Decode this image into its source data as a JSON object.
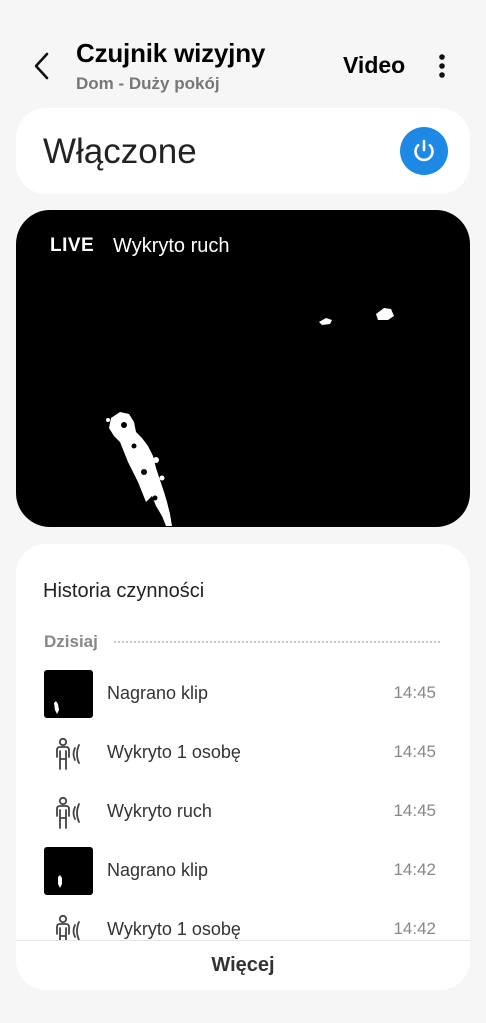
{
  "header": {
    "title": "Czujnik wizyjny",
    "subtitle": "Dom - Duży pokój",
    "video_label": "Video"
  },
  "status": {
    "text": "Włączone",
    "power_on": true,
    "accent": "#1e88e5"
  },
  "live": {
    "badge": "LIVE",
    "status": "Wykryto ruch"
  },
  "history": {
    "title": "Historia czynności",
    "date_label": "Dzisiaj",
    "items": [
      {
        "type": "clip",
        "icon": "clip-thumbnail",
        "label": "Nagrano klip",
        "time": "14:45"
      },
      {
        "type": "person",
        "icon": "person-detected-icon",
        "label": "Wykryto 1 osobę",
        "time": "14:45"
      },
      {
        "type": "motion",
        "icon": "motion-detected-icon",
        "label": "Wykryto ruch",
        "time": "14:45"
      },
      {
        "type": "clip",
        "icon": "clip-thumbnail",
        "label": "Nagrano klip",
        "time": "14:42"
      },
      {
        "type": "person",
        "icon": "person-detected-icon",
        "label": "Wykryto 1 osobę",
        "time": "14:42"
      }
    ],
    "more_label": "Więcej"
  }
}
